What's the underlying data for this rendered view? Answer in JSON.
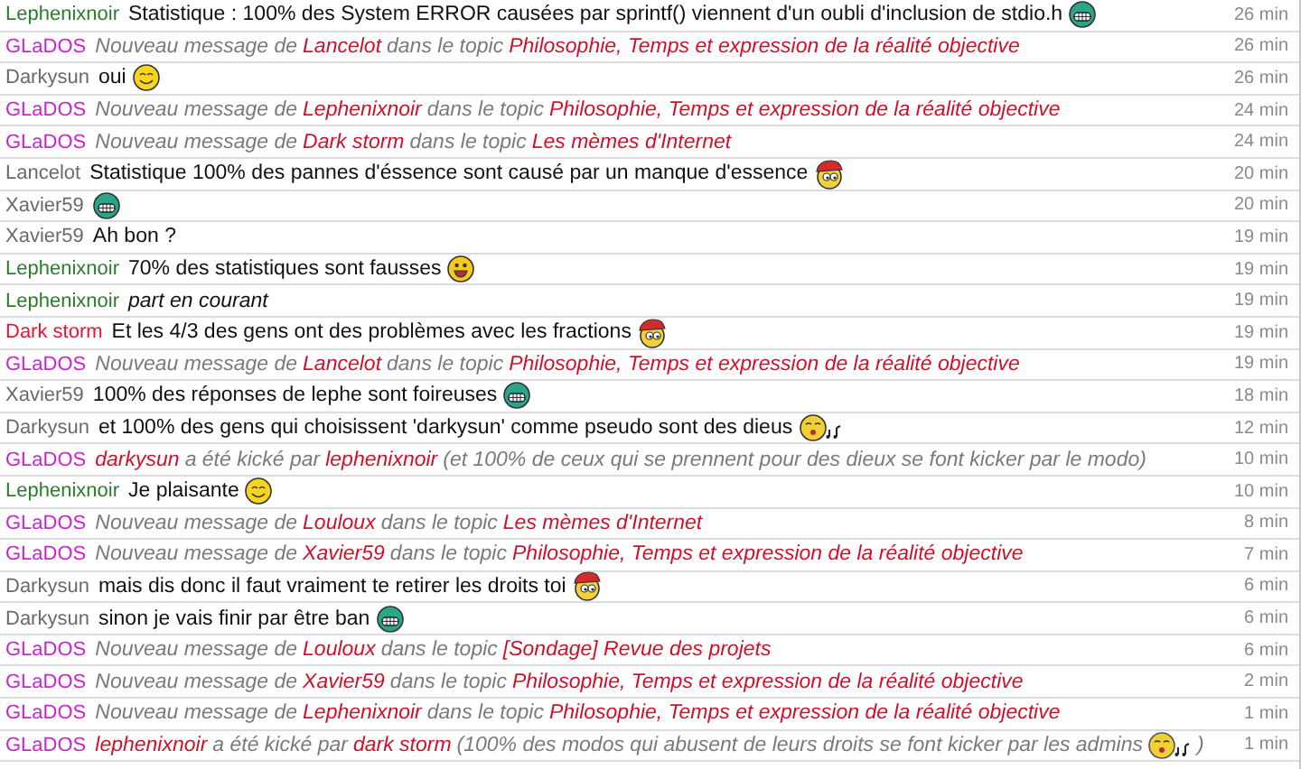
{
  "messages": [
    {
      "author": "Lephenixnoir",
      "color": "#2b7d2b",
      "kind": "chat",
      "time": "26 min",
      "parts": [
        {
          "kind": "text",
          "text": "Statistique : 100% des System ERROR causées par sprintf() viennent d'un oubli d'inclusion de stdio.h"
        },
        {
          "kind": "grin"
        }
      ]
    },
    {
      "author": "GLaDOS",
      "color": "#cc22cc",
      "kind": "notice",
      "time": "26 min",
      "parts": [
        {
          "kind": "text",
          "text": "Nouveau message de"
        },
        {
          "kind": "name",
          "text": "Lancelot"
        },
        {
          "kind": "text",
          "text": "dans le topic"
        },
        {
          "kind": "name",
          "text": "Philosophie, Temps et expression de la réalité objective"
        }
      ]
    },
    {
      "author": "Darkysun",
      "color": "#6a6a6a",
      "kind": "chat",
      "time": "26 min",
      "parts": [
        {
          "kind": "text",
          "text": "oui"
        },
        {
          "kind": "smile"
        }
      ]
    },
    {
      "author": "GLaDOS",
      "color": "#cc22cc",
      "kind": "notice",
      "time": "24 min",
      "parts": [
        {
          "kind": "text",
          "text": "Nouveau message de"
        },
        {
          "kind": "name",
          "text": "Lephenixnoir"
        },
        {
          "kind": "text",
          "text": "dans le topic"
        },
        {
          "kind": "name",
          "text": "Philosophie, Temps et expression de la réalité objective"
        }
      ]
    },
    {
      "author": "GLaDOS",
      "color": "#cc22cc",
      "kind": "notice",
      "time": "24 min",
      "parts": [
        {
          "kind": "text",
          "text": "Nouveau message de"
        },
        {
          "kind": "name",
          "text": "Dark storm"
        },
        {
          "kind": "text",
          "text": "dans le topic"
        },
        {
          "kind": "name",
          "text": "Les mèmes d'Internet"
        }
      ]
    },
    {
      "author": "Lancelot",
      "color": "#6a6a6a",
      "kind": "chat",
      "time": "20 min",
      "parts": [
        {
          "kind": "text",
          "text": "Statistique 100% des pannes d'éssence sont causé par un manque d'essence"
        },
        {
          "kind": "cap"
        }
      ]
    },
    {
      "author": "Xavier59",
      "color": "#6a6a6a",
      "kind": "chat",
      "time": "20 min",
      "parts": [
        {
          "kind": "grin"
        }
      ]
    },
    {
      "author": "Xavier59",
      "color": "#6a6a6a",
      "kind": "chat",
      "time": "19 min",
      "parts": [
        {
          "kind": "text",
          "text": "Ah bon ?"
        }
      ]
    },
    {
      "author": "Lephenixnoir",
      "color": "#2b7d2b",
      "kind": "chat",
      "time": "19 min",
      "parts": [
        {
          "kind": "text",
          "text": "70% des statistiques sont fausses"
        },
        {
          "kind": "happy"
        }
      ]
    },
    {
      "author": "Lephenixnoir",
      "color": "#2b7d2b",
      "kind": "action",
      "time": "19 min",
      "parts": [
        {
          "kind": "text",
          "text": "part en courant"
        }
      ]
    },
    {
      "author": "Dark storm",
      "color": "#ee1133",
      "kind": "chat",
      "time": "19 min",
      "parts": [
        {
          "kind": "text",
          "text": "Et les 4/3 des gens ont des problèmes avec les fractions"
        },
        {
          "kind": "cap"
        }
      ]
    },
    {
      "author": "GLaDOS",
      "color": "#cc22cc",
      "kind": "notice",
      "time": "19 min",
      "parts": [
        {
          "kind": "text",
          "text": "Nouveau message de"
        },
        {
          "kind": "name",
          "text": "Lancelot"
        },
        {
          "kind": "text",
          "text": "dans le topic"
        },
        {
          "kind": "name",
          "text": "Philosophie, Temps et expression de la réalité objective"
        }
      ]
    },
    {
      "author": "Xavier59",
      "color": "#6a6a6a",
      "kind": "chat",
      "time": "18 min",
      "parts": [
        {
          "kind": "text",
          "text": "100% des réponses de lephe sont foireuses"
        },
        {
          "kind": "grin"
        }
      ]
    },
    {
      "author": "Darkysun",
      "color": "#6a6a6a",
      "kind": "chat",
      "time": "12 min",
      "parts": [
        {
          "kind": "text",
          "text": "et 100% des gens qui choisissent 'darkysun' comme pseudo sont des dieus"
        },
        {
          "kind": "sing"
        }
      ]
    },
    {
      "author": "GLaDOS",
      "color": "#cc22cc",
      "kind": "notice",
      "time": "10 min",
      "parts": [
        {
          "kind": "name",
          "text": "darkysun"
        },
        {
          "kind": "text",
          "text": "a été kické par"
        },
        {
          "kind": "name",
          "text": "lephenixnoir"
        },
        {
          "kind": "text",
          "text": "(et 100% de ceux qui se prennent pour des dieux se font kicker par le modo)"
        }
      ]
    },
    {
      "author": "Lephenixnoir",
      "color": "#2b7d2b",
      "kind": "chat",
      "time": "10 min",
      "parts": [
        {
          "kind": "text",
          "text": "Je plaisante"
        },
        {
          "kind": "smile"
        }
      ]
    },
    {
      "author": "GLaDOS",
      "color": "#cc22cc",
      "kind": "notice",
      "time": "8 min",
      "parts": [
        {
          "kind": "text",
          "text": "Nouveau message de"
        },
        {
          "kind": "name",
          "text": "Louloux"
        },
        {
          "kind": "text",
          "text": "dans le topic"
        },
        {
          "kind": "name",
          "text": "Les mèmes d'Internet"
        }
      ]
    },
    {
      "author": "GLaDOS",
      "color": "#cc22cc",
      "kind": "notice",
      "time": "7 min",
      "parts": [
        {
          "kind": "text",
          "text": "Nouveau message de"
        },
        {
          "kind": "name",
          "text": "Xavier59"
        },
        {
          "kind": "text",
          "text": "dans le topic"
        },
        {
          "kind": "name",
          "text": "Philosophie, Temps et expression de la réalité objective"
        }
      ]
    },
    {
      "author": "Darkysun",
      "color": "#6a6a6a",
      "kind": "chat",
      "time": "6 min",
      "parts": [
        {
          "kind": "text",
          "text": "mais dis donc il faut vraiment te retirer les droits toi"
        },
        {
          "kind": "cap"
        }
      ]
    },
    {
      "author": "Darkysun",
      "color": "#6a6a6a",
      "kind": "chat",
      "time": "6 min",
      "parts": [
        {
          "kind": "text",
          "text": "sinon je vais finir par être ban"
        },
        {
          "kind": "grin"
        }
      ]
    },
    {
      "author": "GLaDOS",
      "color": "#cc22cc",
      "kind": "notice",
      "time": "6 min",
      "parts": [
        {
          "kind": "text",
          "text": "Nouveau message de"
        },
        {
          "kind": "name",
          "text": "Louloux"
        },
        {
          "kind": "text",
          "text": "dans le topic"
        },
        {
          "kind": "name",
          "text": "[Sondage] Revue des projets"
        }
      ]
    },
    {
      "author": "GLaDOS",
      "color": "#cc22cc",
      "kind": "notice",
      "time": "2 min",
      "parts": [
        {
          "kind": "text",
          "text": "Nouveau message de"
        },
        {
          "kind": "name",
          "text": "Xavier59"
        },
        {
          "kind": "text",
          "text": "dans le topic"
        },
        {
          "kind": "name",
          "text": "Philosophie, Temps et expression de la réalité objective"
        }
      ]
    },
    {
      "author": "GLaDOS",
      "color": "#cc22cc",
      "kind": "notice",
      "time": "1 min",
      "parts": [
        {
          "kind": "text",
          "text": "Nouveau message de"
        },
        {
          "kind": "name",
          "text": "Lephenixnoir"
        },
        {
          "kind": "text",
          "text": "dans le topic"
        },
        {
          "kind": "name",
          "text": "Philosophie, Temps et expression de la réalité objective"
        }
      ]
    },
    {
      "author": "GLaDOS",
      "color": "#cc22cc",
      "kind": "notice",
      "time": "1 min",
      "parts": [
        {
          "kind": "name",
          "text": "lephenixnoir"
        },
        {
          "kind": "text",
          "text": "a été kické par"
        },
        {
          "kind": "name",
          "text": "dark storm"
        },
        {
          "kind": "text",
          "text": "(100% des modos qui abusent de leurs droits se font kicker par les admins"
        },
        {
          "kind": "sing"
        },
        {
          "kind": "text",
          "text": ")"
        }
      ]
    }
  ]
}
